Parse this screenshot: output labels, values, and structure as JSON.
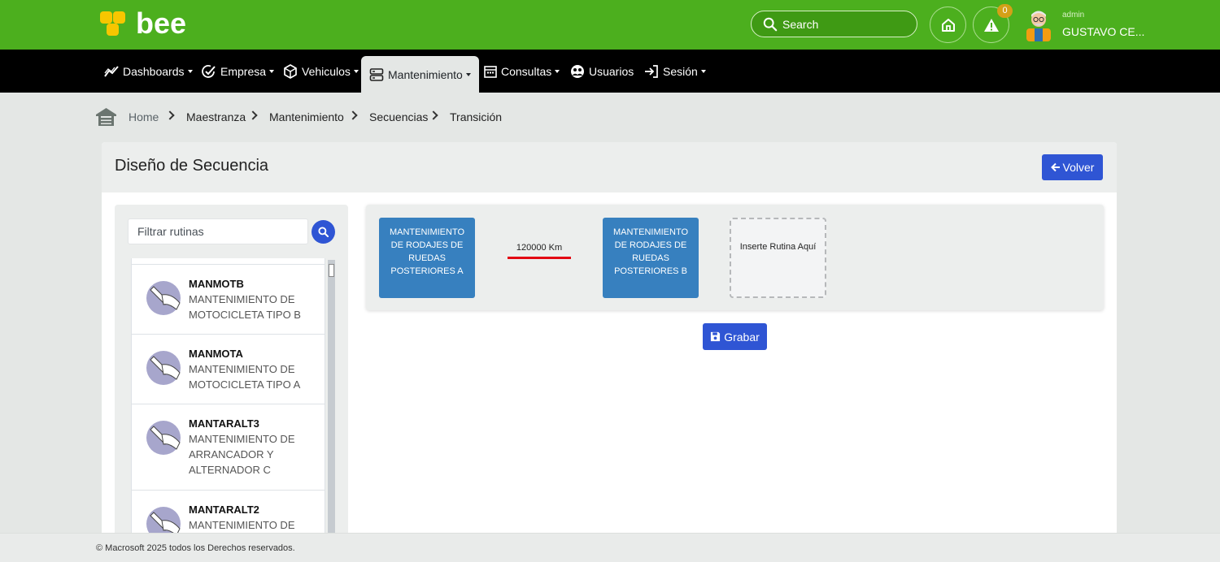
{
  "brand": {
    "name": "bee",
    "accent": "#4caf1e",
    "logo_color": "#f7c600"
  },
  "header": {
    "search_placeholder": "Search",
    "alerts_count": "0",
    "user_role": "admin",
    "user_name": "GUSTAVO CE..."
  },
  "nav": {
    "items": [
      {
        "label": "Dashboards",
        "icon": "trend-icon"
      },
      {
        "label": "Empresa",
        "icon": "check-edit-icon"
      },
      {
        "label": "Vehiculos",
        "icon": "cube-icon"
      },
      {
        "label": "Mantenimiento",
        "icon": "server-icon",
        "active": true
      },
      {
        "label": "Consultas",
        "icon": "calendar-icon"
      },
      {
        "label": "Usuarios",
        "icon": "users-icon"
      },
      {
        "label": "Sesión",
        "icon": "sign-in-icon"
      }
    ]
  },
  "breadcrumb": [
    "Home",
    "Maestranza",
    "Mantenimiento",
    "Secuencias",
    "Transición"
  ],
  "page": {
    "title": "Diseño de Secuencia",
    "back_label": "Volver",
    "save_label": "Grabar"
  },
  "filter": {
    "placeholder": "Filtrar rutinas"
  },
  "routines": [
    {
      "code": "MANMOTB",
      "desc": "MANTENIMIENTO DE MOTOCICLETA TIPO B"
    },
    {
      "code": "MANMOTA",
      "desc": "MANTENIMIENTO DE MOTOCICLETA TIPO A"
    },
    {
      "code": "MANTARALT3",
      "desc": "MANTENIMIENTO DE ARRANCADOR Y ALTERNADOR C"
    },
    {
      "code": "MANTARALT2",
      "desc": "MANTENIMIENTO DE"
    }
  ],
  "sequence": {
    "first": "MANTENIMIENTO DE RODAJES DE RUEDAS POSTERIORES A",
    "transition": "120000 Km",
    "second": "MANTENIMIENTO DE RODAJES DE RUEDAS POSTERIORES B",
    "drop_zone": "Inserte Rutina Aquí",
    "routine_color": "#3780bf",
    "transition_color": "#e30613"
  },
  "footer": {
    "text": "© Macrosoft 2025 todos los Derechos reservados."
  }
}
